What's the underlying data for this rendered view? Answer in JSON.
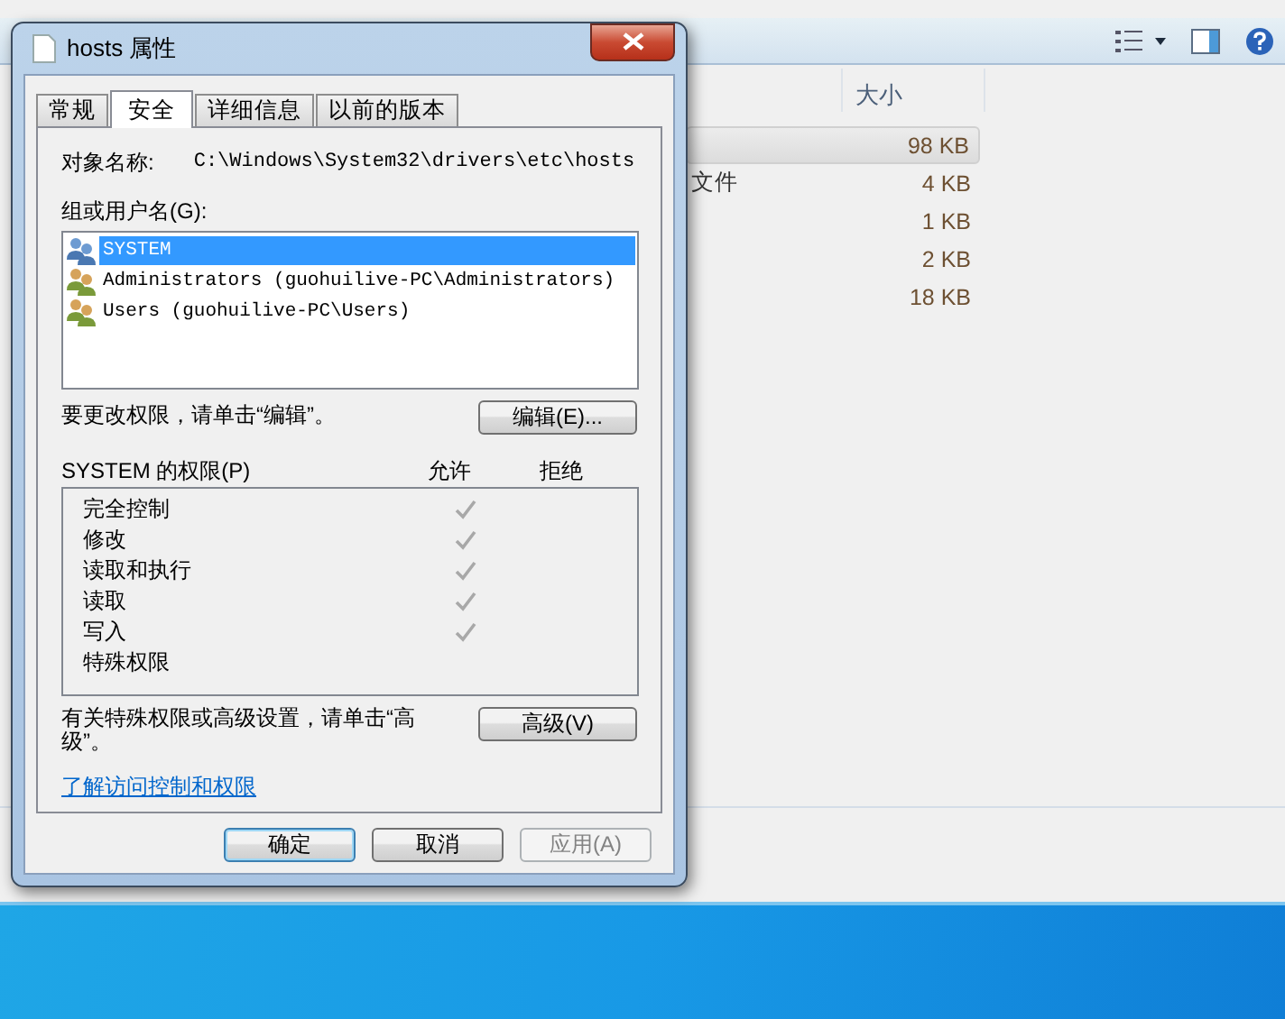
{
  "explorer": {
    "column_header": "大小",
    "rows": [
      {
        "type": "",
        "size": "98 KB",
        "selected": true
      },
      {
        "type": "文件",
        "size": "4 KB",
        "selected": false
      },
      {
        "type": "",
        "size": "1 KB",
        "selected": false
      },
      {
        "type": "",
        "size": "2 KB",
        "selected": false
      },
      {
        "type": "",
        "size": "18 KB",
        "selected": false
      }
    ]
  },
  "dialog": {
    "title": "hosts 属性",
    "tabs": [
      {
        "label": "常规",
        "selected": false
      },
      {
        "label": "安全",
        "selected": true
      },
      {
        "label": "详细信息",
        "selected": false
      },
      {
        "label": "以前的版本",
        "selected": false
      }
    ],
    "object_label": "对象名称:",
    "object_path": "C:\\Windows\\System32\\drivers\\etc\\hosts",
    "groups_label": "组或用户名(G):",
    "principals": [
      {
        "name": "SYSTEM",
        "kind": "system",
        "selected": true
      },
      {
        "name": "Administrators (guohuilive-PC\\Administrators)",
        "kind": "group",
        "selected": false
      },
      {
        "name": "Users (guohuilive-PC\\Users)",
        "kind": "group",
        "selected": false
      }
    ],
    "edit_hint": "要更改权限，请单击“编辑”。",
    "edit_button": "编辑(E)...",
    "permissions_label": "SYSTEM 的权限(P)",
    "allow_header": "允许",
    "deny_header": "拒绝",
    "permissions": [
      {
        "name": "完全控制",
        "allow": true,
        "deny": false
      },
      {
        "name": "修改",
        "allow": true,
        "deny": false
      },
      {
        "name": "读取和执行",
        "allow": true,
        "deny": false
      },
      {
        "name": "读取",
        "allow": true,
        "deny": false
      },
      {
        "name": "写入",
        "allow": true,
        "deny": false
      },
      {
        "name": "特殊权限",
        "allow": false,
        "deny": false
      }
    ],
    "advanced_hint": "有关特殊权限或高级设置，请单击“高级”。",
    "advanced_button": "高级(V)",
    "link": "了解访问控制和权限",
    "buttons": [
      {
        "label": "确定",
        "kind": "default"
      },
      {
        "label": "取消",
        "kind": "normal"
      },
      {
        "label": "应用(A)",
        "kind": "disabled"
      }
    ]
  }
}
